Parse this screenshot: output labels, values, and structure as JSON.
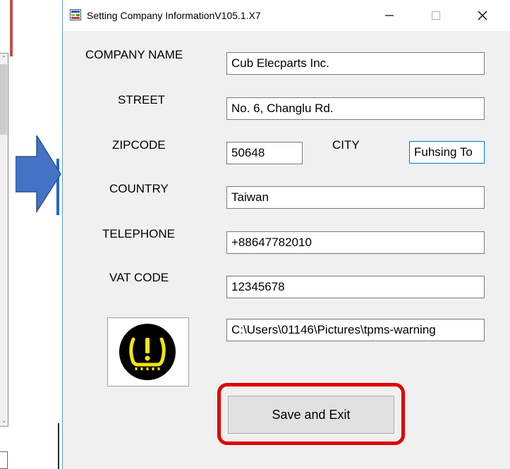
{
  "window": {
    "title": "Setting Company InformationV105.1.X7",
    "icons": {
      "app": "app-window-icon",
      "minimize": "minimize-icon",
      "maximize": "maximize-icon",
      "close": "close-icon"
    }
  },
  "form": {
    "company_name": {
      "label": "COMPANY NAME",
      "value": "Cub Elecparts Inc."
    },
    "street": {
      "label": "STREET",
      "value": "No. 6, Changlu Rd."
    },
    "zipcode": {
      "label": "ZIPCODE",
      "value": "50648"
    },
    "city": {
      "label": "CITY",
      "value": "Fuhsing To"
    },
    "country": {
      "label": "COUNTRY",
      "value": "Taiwan"
    },
    "telephone": {
      "label": "TELEPHONE",
      "value": "+88647782010"
    },
    "vat_code": {
      "label": "VAT CODE",
      "value": "12345678"
    },
    "logo_path": {
      "value": "C:\\Users\\01146\\Pictures\\tpms-warning"
    },
    "logo_icon": "tpms-warning-icon"
  },
  "actions": {
    "save_label": "Save and Exit"
  },
  "colors": {
    "dialog_bg": "#f0f0f0",
    "highlight": "#e00000",
    "arrow": "#4472c4",
    "tpms_yellow": "#f5e50a"
  }
}
